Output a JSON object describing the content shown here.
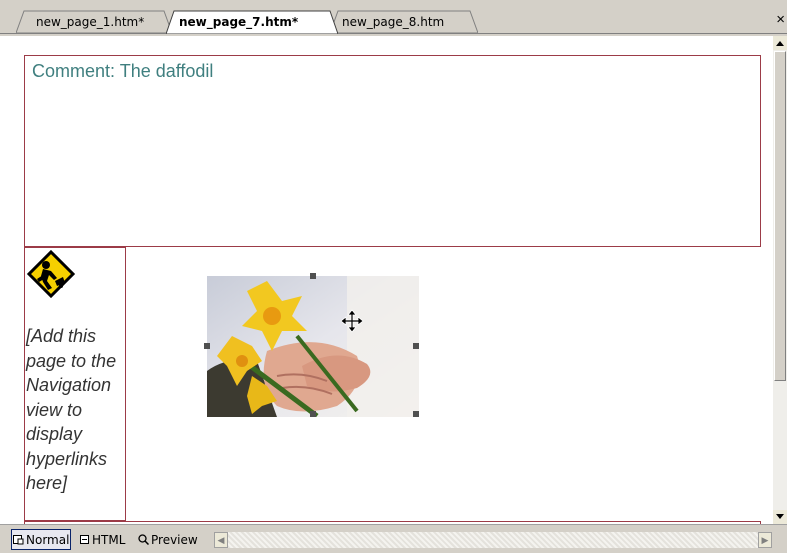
{
  "tabs": [
    {
      "label": "new_page_1.htm*",
      "active": false
    },
    {
      "label": "new_page_7.htm*",
      "active": true
    },
    {
      "label": "new_page_8.htm",
      "active": false
    }
  ],
  "close_label": "×",
  "editor": {
    "comment": "Comment: The daffodil",
    "nav_placeholder": "[Add this page to the Navigation view to display hyperlinks here]",
    "nav_icon": "under-construction-icon",
    "image": "daffodil-in-hands-photo"
  },
  "view_modes": [
    {
      "label": "Normal",
      "icon": "normal-view-icon",
      "active": true
    },
    {
      "label": "HTML",
      "icon": "html-view-icon",
      "active": false
    },
    {
      "label": "Preview",
      "icon": "preview-view-icon",
      "active": false
    }
  ],
  "colors": {
    "table_border": "#9c3b47",
    "comment_text": "#3f7f7f",
    "chrome": "#d4d0c8"
  }
}
